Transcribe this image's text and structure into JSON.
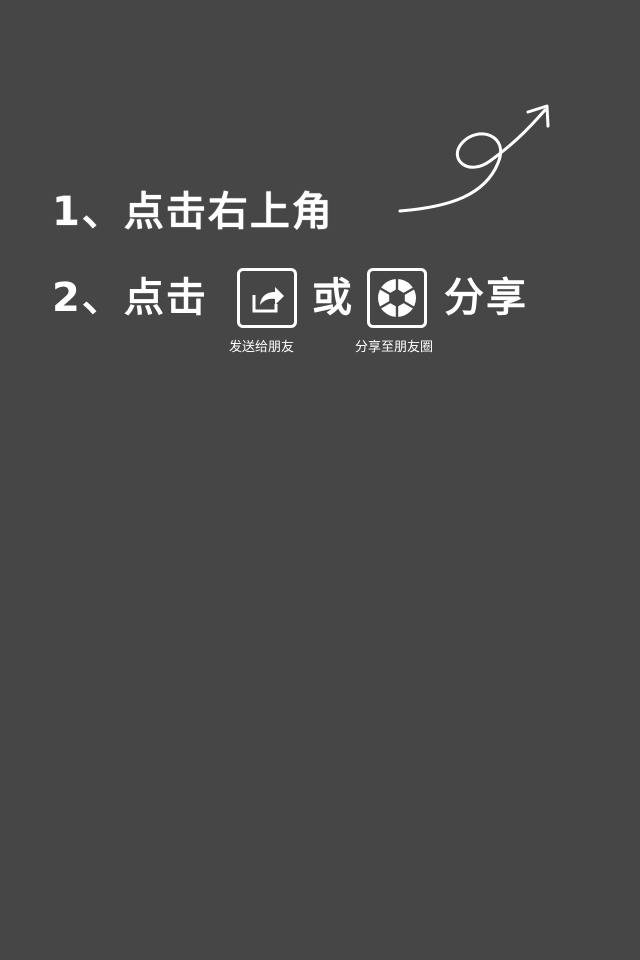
{
  "theme": {
    "background": "#464646",
    "foreground": "#ffffff"
  },
  "guide": {
    "step1": "1、点击右上角",
    "step2_prefix": "2、点击",
    "step2_or": "或",
    "step2_share": "分享",
    "send_to_friend": {
      "icon": "share-forward-icon",
      "caption": "发送给朋友"
    },
    "share_to_moments": {
      "icon": "camera-aperture-icon",
      "caption": "分享至朋友圈"
    }
  }
}
